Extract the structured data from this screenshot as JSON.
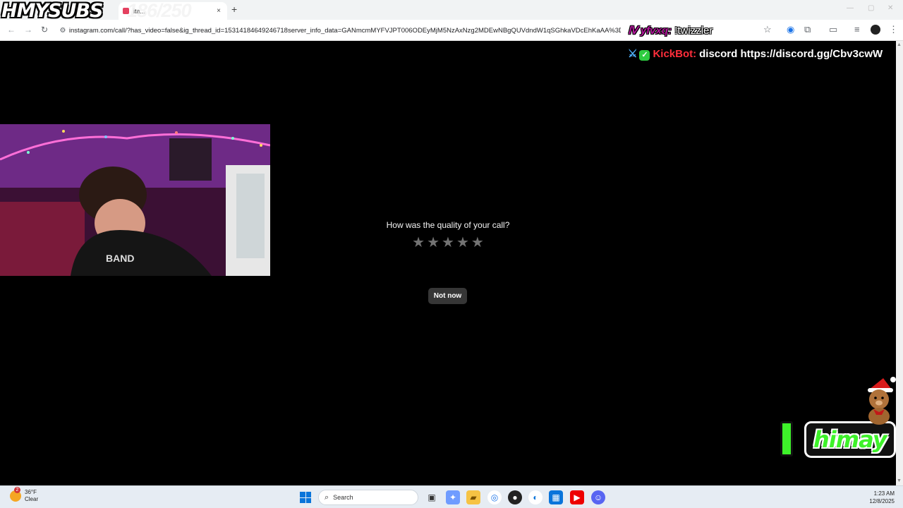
{
  "overlay": {
    "logo_text": "HMYSUBS",
    "sub_count": "186/250",
    "chat_top": {
      "user": "yfvxq:",
      "message": "!twizzler"
    },
    "kick_line": {
      "bot": "KickBot:",
      "message": "discord https://discord.gg/Cbv3cwW"
    },
    "himay_label": "himay"
  },
  "browser": {
    "tab_title": "ita...",
    "tab_close": "×",
    "new_tab": "+",
    "url": "instagram.com/call/?has_video=false&ig_thread_id=15314184649246718server_info_data=GANmcmMYFVJPT006ODEyMjM5NzAxNzg2MDEwNBgQUVdndW1qSGhkaVDcEhKaAA%3D"
  },
  "dialog": {
    "question": "How was the quality of your call?",
    "stars": [
      "★",
      "★",
      "★",
      "★",
      "★"
    ],
    "not_now_label": "Not now"
  },
  "taskbar": {
    "weather_temp": "36°F",
    "weather_desc": "Clear",
    "weather_badge": "2",
    "search_label": "Search",
    "time": "1:23 AM",
    "date": "12/8/2025"
  }
}
